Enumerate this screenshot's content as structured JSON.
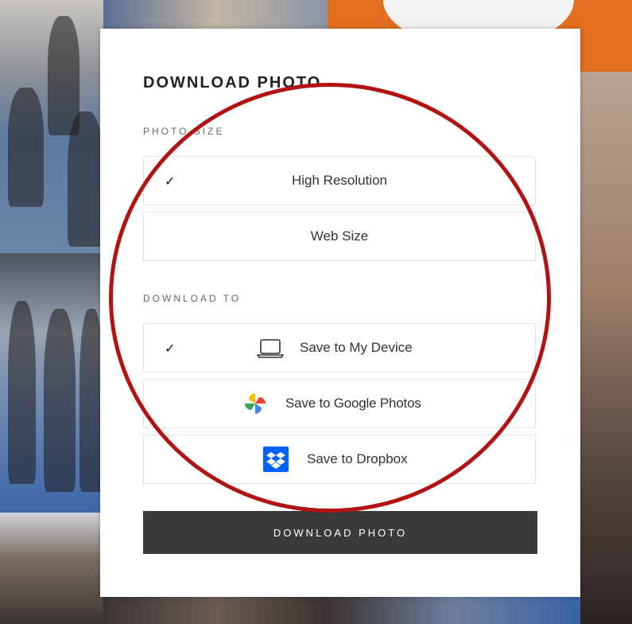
{
  "modal": {
    "title": "DOWNLOAD PHOTO",
    "photo_size": {
      "label": "PHOTO SIZE",
      "options": [
        {
          "label": "High Resolution",
          "selected": true
        },
        {
          "label": "Web Size",
          "selected": false
        }
      ]
    },
    "download_to": {
      "label": "DOWNLOAD TO",
      "options": [
        {
          "label": "Save to My Device",
          "icon": "laptop-icon",
          "selected": true
        },
        {
          "label": "Save to Google Photos",
          "icon": "google-photos-icon",
          "selected": false
        },
        {
          "label": "Save to Dropbox",
          "icon": "dropbox-icon",
          "selected": false
        }
      ]
    },
    "check_mark": "✓",
    "download_button_label": "DOWNLOAD PHOTO"
  },
  "colors": {
    "button_bg": "#3a3a3a",
    "annotation_circle": "#b31212",
    "dropbox_blue": "#0061fe"
  }
}
